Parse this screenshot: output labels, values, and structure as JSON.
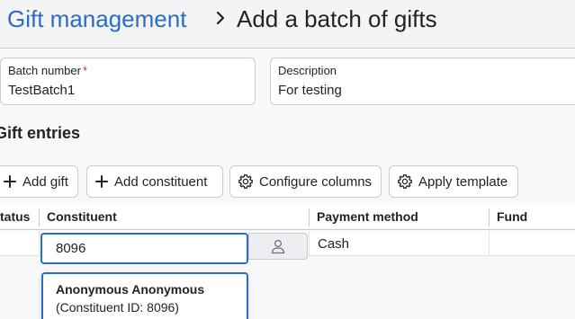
{
  "breadcrumb": {
    "parent": "Gift management",
    "current": "Add a batch of gifts"
  },
  "batch_number": {
    "label": "Batch number",
    "required_mark": "*",
    "value": "TestBatch1"
  },
  "description": {
    "label": "Description",
    "value": "For testing"
  },
  "gift_entries": {
    "title": "Gift entries",
    "buttons": {
      "add_gift": "Add gift",
      "add_constituent": "Add constituent",
      "configure_columns": "Configure columns",
      "apply_template": "Apply template"
    },
    "columns": {
      "status": "tatus",
      "constituent": "Constituent",
      "payment_method": "Payment method",
      "fund": "Fund"
    },
    "row": {
      "constituent_input": "8096",
      "payment_method": "Cash"
    },
    "suggestion": {
      "name": "Anonymous Anonymous",
      "detail": "(Constituent ID: 8096)"
    }
  },
  "icons": {
    "separator": "chevron-right-icon",
    "add": "plus-icon",
    "settings": "gear-icon",
    "lookup": "person-icon"
  },
  "colors": {
    "link": "#2c6cc4",
    "focus_border": "#2c6cc4",
    "required": "#c0392b"
  }
}
